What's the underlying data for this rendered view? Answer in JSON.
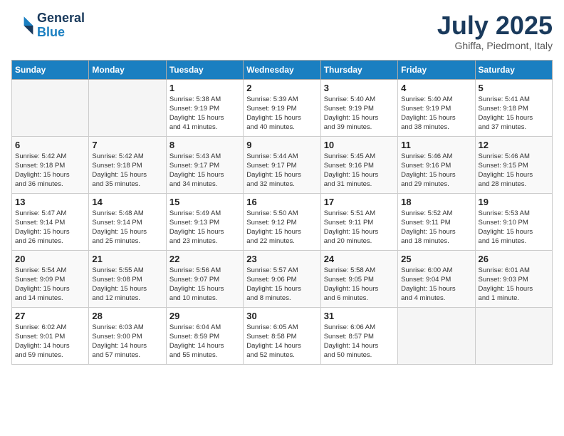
{
  "header": {
    "logo_line1": "General",
    "logo_line2": "Blue",
    "month": "July 2025",
    "location": "Ghiffa, Piedmont, Italy"
  },
  "weekdays": [
    "Sunday",
    "Monday",
    "Tuesday",
    "Wednesday",
    "Thursday",
    "Friday",
    "Saturday"
  ],
  "weeks": [
    [
      {
        "day": "",
        "info": ""
      },
      {
        "day": "",
        "info": ""
      },
      {
        "day": "1",
        "info": "Sunrise: 5:38 AM\nSunset: 9:19 PM\nDaylight: 15 hours\nand 41 minutes."
      },
      {
        "day": "2",
        "info": "Sunrise: 5:39 AM\nSunset: 9:19 PM\nDaylight: 15 hours\nand 40 minutes."
      },
      {
        "day": "3",
        "info": "Sunrise: 5:40 AM\nSunset: 9:19 PM\nDaylight: 15 hours\nand 39 minutes."
      },
      {
        "day": "4",
        "info": "Sunrise: 5:40 AM\nSunset: 9:19 PM\nDaylight: 15 hours\nand 38 minutes."
      },
      {
        "day": "5",
        "info": "Sunrise: 5:41 AM\nSunset: 9:18 PM\nDaylight: 15 hours\nand 37 minutes."
      }
    ],
    [
      {
        "day": "6",
        "info": "Sunrise: 5:42 AM\nSunset: 9:18 PM\nDaylight: 15 hours\nand 36 minutes."
      },
      {
        "day": "7",
        "info": "Sunrise: 5:42 AM\nSunset: 9:18 PM\nDaylight: 15 hours\nand 35 minutes."
      },
      {
        "day": "8",
        "info": "Sunrise: 5:43 AM\nSunset: 9:17 PM\nDaylight: 15 hours\nand 34 minutes."
      },
      {
        "day": "9",
        "info": "Sunrise: 5:44 AM\nSunset: 9:17 PM\nDaylight: 15 hours\nand 32 minutes."
      },
      {
        "day": "10",
        "info": "Sunrise: 5:45 AM\nSunset: 9:16 PM\nDaylight: 15 hours\nand 31 minutes."
      },
      {
        "day": "11",
        "info": "Sunrise: 5:46 AM\nSunset: 9:16 PM\nDaylight: 15 hours\nand 29 minutes."
      },
      {
        "day": "12",
        "info": "Sunrise: 5:46 AM\nSunset: 9:15 PM\nDaylight: 15 hours\nand 28 minutes."
      }
    ],
    [
      {
        "day": "13",
        "info": "Sunrise: 5:47 AM\nSunset: 9:14 PM\nDaylight: 15 hours\nand 26 minutes."
      },
      {
        "day": "14",
        "info": "Sunrise: 5:48 AM\nSunset: 9:14 PM\nDaylight: 15 hours\nand 25 minutes."
      },
      {
        "day": "15",
        "info": "Sunrise: 5:49 AM\nSunset: 9:13 PM\nDaylight: 15 hours\nand 23 minutes."
      },
      {
        "day": "16",
        "info": "Sunrise: 5:50 AM\nSunset: 9:12 PM\nDaylight: 15 hours\nand 22 minutes."
      },
      {
        "day": "17",
        "info": "Sunrise: 5:51 AM\nSunset: 9:11 PM\nDaylight: 15 hours\nand 20 minutes."
      },
      {
        "day": "18",
        "info": "Sunrise: 5:52 AM\nSunset: 9:11 PM\nDaylight: 15 hours\nand 18 minutes."
      },
      {
        "day": "19",
        "info": "Sunrise: 5:53 AM\nSunset: 9:10 PM\nDaylight: 15 hours\nand 16 minutes."
      }
    ],
    [
      {
        "day": "20",
        "info": "Sunrise: 5:54 AM\nSunset: 9:09 PM\nDaylight: 15 hours\nand 14 minutes."
      },
      {
        "day": "21",
        "info": "Sunrise: 5:55 AM\nSunset: 9:08 PM\nDaylight: 15 hours\nand 12 minutes."
      },
      {
        "day": "22",
        "info": "Sunrise: 5:56 AM\nSunset: 9:07 PM\nDaylight: 15 hours\nand 10 minutes."
      },
      {
        "day": "23",
        "info": "Sunrise: 5:57 AM\nSunset: 9:06 PM\nDaylight: 15 hours\nand 8 minutes."
      },
      {
        "day": "24",
        "info": "Sunrise: 5:58 AM\nSunset: 9:05 PM\nDaylight: 15 hours\nand 6 minutes."
      },
      {
        "day": "25",
        "info": "Sunrise: 6:00 AM\nSunset: 9:04 PM\nDaylight: 15 hours\nand 4 minutes."
      },
      {
        "day": "26",
        "info": "Sunrise: 6:01 AM\nSunset: 9:03 PM\nDaylight: 15 hours\nand 1 minute."
      }
    ],
    [
      {
        "day": "27",
        "info": "Sunrise: 6:02 AM\nSunset: 9:01 PM\nDaylight: 14 hours\nand 59 minutes."
      },
      {
        "day": "28",
        "info": "Sunrise: 6:03 AM\nSunset: 9:00 PM\nDaylight: 14 hours\nand 57 minutes."
      },
      {
        "day": "29",
        "info": "Sunrise: 6:04 AM\nSunset: 8:59 PM\nDaylight: 14 hours\nand 55 minutes."
      },
      {
        "day": "30",
        "info": "Sunrise: 6:05 AM\nSunset: 8:58 PM\nDaylight: 14 hours\nand 52 minutes."
      },
      {
        "day": "31",
        "info": "Sunrise: 6:06 AM\nSunset: 8:57 PM\nDaylight: 14 hours\nand 50 minutes."
      },
      {
        "day": "",
        "info": ""
      },
      {
        "day": "",
        "info": ""
      }
    ]
  ]
}
